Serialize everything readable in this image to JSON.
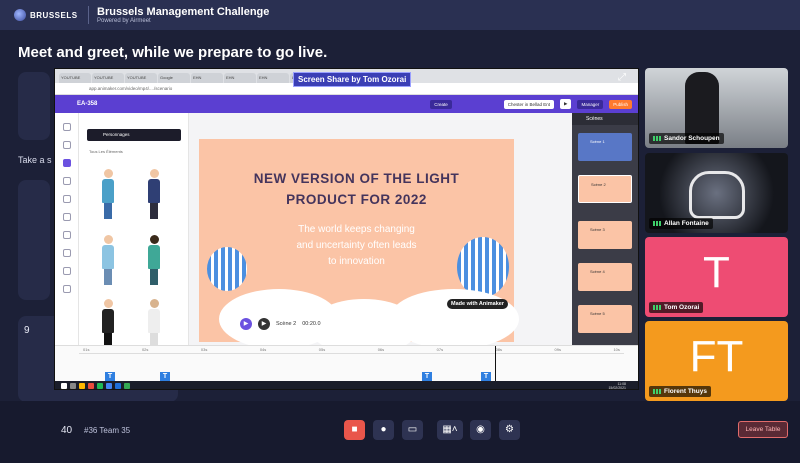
{
  "header": {
    "logo_text": "BRUSSELS",
    "event_title": "Brussels Management Challenge",
    "event_subtitle": "Powered by Airmeet"
  },
  "page": {
    "title": "Meet and greet, while we prepare to go live.",
    "take_seat": "Take a s",
    "table_number": "9"
  },
  "screen_share": {
    "label": "Screen Share by Tom Ozorai",
    "browser_tabs": [
      "YOUTUBE",
      "YOUTUBE",
      "YOUTUBE",
      "Google",
      "EHN",
      "EHN",
      "EHN",
      "Light",
      "EHN",
      "EA-358"
    ],
    "address": "app.animaker.com/video/mp4/..../scenario",
    "project_name": "EA-358",
    "toolbar_buttons": {
      "center": "Create",
      "upgrade": "Chester in Bellad Ent",
      "manager": "Manager",
      "publish": "Publish"
    },
    "char_tab_label": "Personnages",
    "char_subtitle": "Tous Les Éléments",
    "stage": {
      "title_line1": "NEW VERSION OF THE LIGHT",
      "title_line2": "PRODUCT FOR 2022",
      "body_line1": "The world keeps changing",
      "body_line2": "and uncertainty often leads",
      "body_line3": "to innovation",
      "badge": "Made with Animaker"
    },
    "scene_label": "Scène 2",
    "scene_time": "00:20.0",
    "scenes_header": "Scènes",
    "scenes": [
      "Scène 1",
      "Scène 2",
      "Scène 3",
      "Scène 4",
      "Scène 5",
      "Scène 6"
    ],
    "timeline_ticks": [
      "01s",
      "02s",
      "03s",
      "04s",
      "05s",
      "06s",
      "07s",
      "08s",
      "09s",
      "10s"
    ],
    "taskbar_time": "11:08",
    "taskbar_date": "15/02/2021"
  },
  "participants": [
    {
      "name": "Sandor Schoupen",
      "initials": "",
      "color": "#5a5f66"
    },
    {
      "name": "Allan Fontaine",
      "initials": "",
      "color": "#262a36"
    },
    {
      "name": "Tom Ozorai",
      "initials": "T",
      "color": "#ee4c73"
    },
    {
      "name": "Florent Thuys",
      "initials": "FT",
      "color": "#f49a1e"
    }
  ],
  "bottom_bar": {
    "count": "40",
    "team": "#36 Team 35",
    "leave_label": "Leave Table"
  },
  "icons": {
    "video_off": "video-off-icon",
    "mic": "mic-icon",
    "share": "share-screen-icon",
    "layout": "layout-icon",
    "chat": "chat-icon",
    "settings": "gear-icon"
  }
}
